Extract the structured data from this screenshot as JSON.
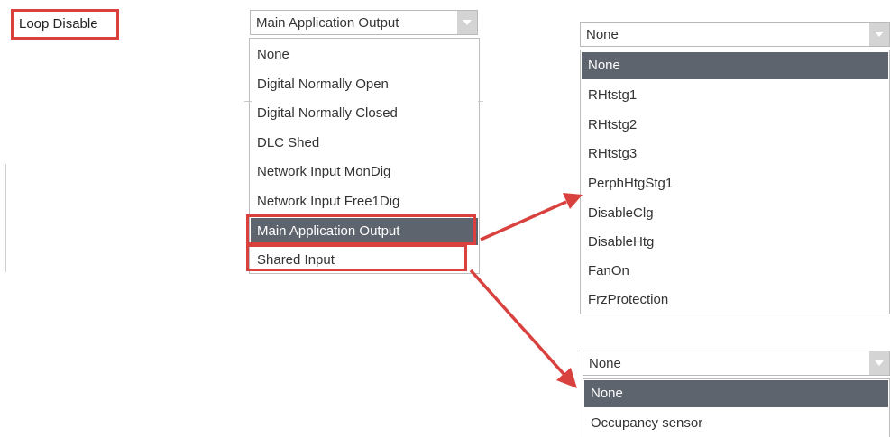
{
  "field": {
    "label": "Loop Disable"
  },
  "main_dropdown": {
    "value": "Main Application Output",
    "options": [
      "None",
      "Digital Normally Open",
      "Digital Normally Closed",
      "DLC Shed",
      "Network Input MonDig",
      "Network Input Free1Dig",
      "Main Application Output",
      "Shared Input"
    ],
    "selected_option": "Main Application Output"
  },
  "app_output_dropdown": {
    "value": "None",
    "options": [
      "None",
      "RHtstg1",
      "RHtstg2",
      "RHtstg3",
      "PerphHtgStg1",
      "DisableClg",
      "DisableHtg",
      "FanOn",
      "FrzProtection"
    ],
    "selected_option": "None"
  },
  "shared_input_dropdown": {
    "value": "None",
    "options": [
      "None",
      "Occupancy sensor"
    ],
    "selected_option": "None"
  },
  "colors": {
    "highlight_red": "#d9413f",
    "selected_row": "#5e646e",
    "dropdown_arrow_bg": "#d4d4d4"
  },
  "icons": {
    "dropdown_arrow": "chevron-down-icon",
    "callout_arrow": "arrow-icon"
  }
}
